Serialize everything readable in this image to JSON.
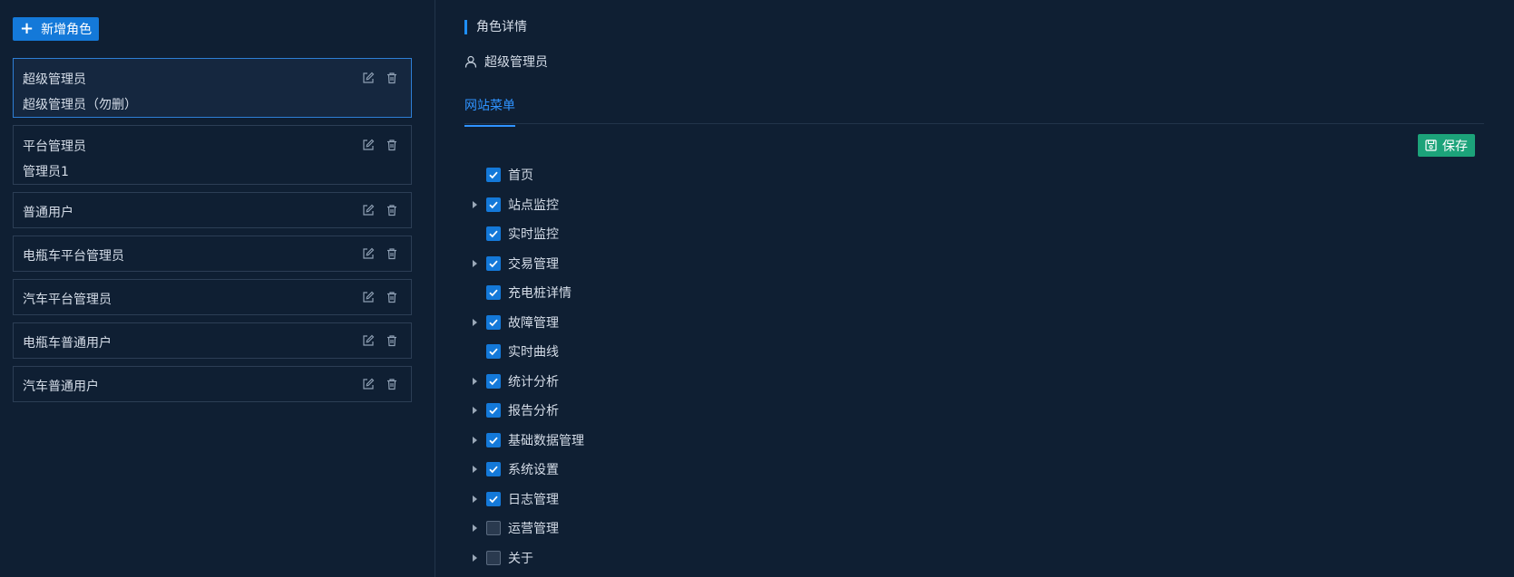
{
  "left": {
    "add_button_label": "新增角色",
    "roles": [
      {
        "name": "超级管理员",
        "desc": "超级管理员（勿删）",
        "active": true
      },
      {
        "name": "平台管理员",
        "desc": "管理员1",
        "active": false
      },
      {
        "name": "普通用户",
        "desc": "",
        "active": false
      },
      {
        "name": "电瓶车平台管理员",
        "desc": "",
        "active": false
      },
      {
        "name": "汽车平台管理员",
        "desc": "",
        "active": false
      },
      {
        "name": "电瓶车普通用户",
        "desc": "",
        "active": false
      },
      {
        "name": "汽车普通用户",
        "desc": "",
        "active": false
      }
    ]
  },
  "right": {
    "section_title": "角色详情",
    "role_name": "超级管理员",
    "tab_label": "网站菜单",
    "save_label": "保存",
    "menu": [
      {
        "label": "首页",
        "checked": true,
        "expandable": false
      },
      {
        "label": "站点监控",
        "checked": true,
        "expandable": true
      },
      {
        "label": "实时监控",
        "checked": true,
        "expandable": false
      },
      {
        "label": "交易管理",
        "checked": true,
        "expandable": true
      },
      {
        "label": "充电桩详情",
        "checked": true,
        "expandable": false
      },
      {
        "label": "故障管理",
        "checked": true,
        "expandable": true
      },
      {
        "label": "实时曲线",
        "checked": true,
        "expandable": false
      },
      {
        "label": "统计分析",
        "checked": true,
        "expandable": true
      },
      {
        "label": "报告分析",
        "checked": true,
        "expandable": true
      },
      {
        "label": "基础数据管理",
        "checked": true,
        "expandable": true
      },
      {
        "label": "系统设置",
        "checked": true,
        "expandable": true
      },
      {
        "label": "日志管理",
        "checked": true,
        "expandable": true
      },
      {
        "label": "运营管理",
        "checked": false,
        "expandable": true
      },
      {
        "label": "关于",
        "checked": false,
        "expandable": true
      }
    ]
  },
  "colors": {
    "background": "#0f1f33",
    "primary": "#1479d9",
    "tab_active": "#2f93ff",
    "save": "#1ca37a"
  }
}
